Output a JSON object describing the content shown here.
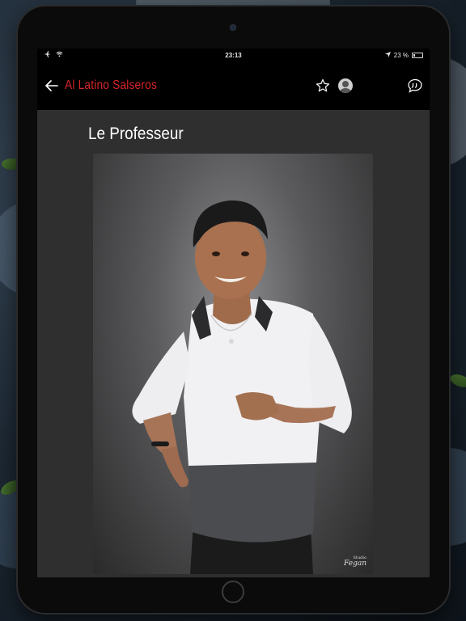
{
  "status_bar": {
    "time": "23:13",
    "battery_percent": "23 %",
    "battery_level": 0.23,
    "icons": [
      "airplane-icon",
      "wifi-icon",
      "location-arrow-icon",
      "battery-icon"
    ]
  },
  "nav": {
    "title": "Al Latino Salseros",
    "title_color": "#d6262b",
    "icons": [
      "back-arrow-icon",
      "star-icon",
      "avatar",
      "quote-bubble-icon"
    ]
  },
  "article": {
    "title": "Le Professeur"
  },
  "photo": {
    "watermark": "Fegan",
    "watermark_sub": "Studio"
  }
}
